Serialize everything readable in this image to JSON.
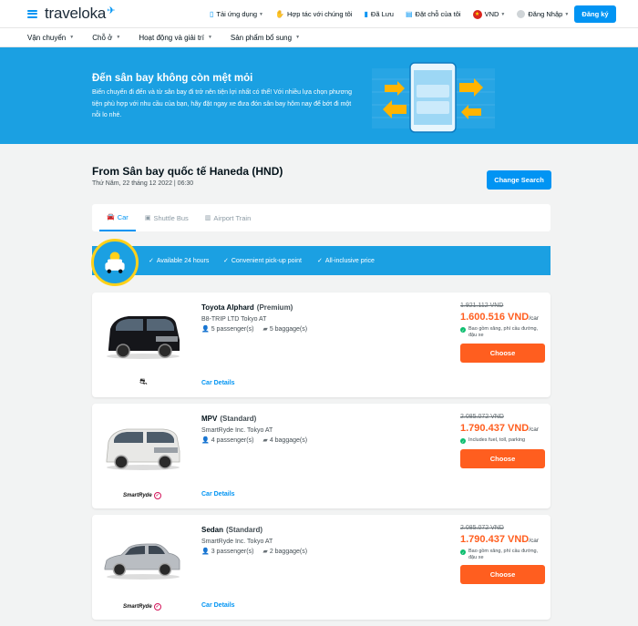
{
  "header": {
    "logo_text": "traveloka",
    "nav": {
      "download": "Tải ứng dụng",
      "partner": "Hợp tác với chúng tôi",
      "saved": "Đã Lưu",
      "bookings": "Đặt chỗ của tôi",
      "currency": "VND",
      "login": "Đăng Nhập",
      "signup": "Đăng ký"
    },
    "subnav": [
      "Vận chuyển",
      "Chỗ ở",
      "Hoạt động và giải trí",
      "Sản phẩm bổ sung"
    ]
  },
  "banner": {
    "title": "Đến sân bay không còn mệt mỏi",
    "text": "Biến chuyến đi đến và từ sân bay đi trở nên tiện lợi nhất có thể! Với nhiều lựa chọn phương tiện phù hợp với nhu cầu của bạn, hãy đặt ngay xe đưa đón sân bay hôm nay để bớt đi một nỗi lo nhé."
  },
  "search": {
    "title": "From Sân bay quốc tế Haneda (HND)",
    "date": "Thứ Năm, 22 tháng 12 2022 | 06:30",
    "change_label": "Change Search"
  },
  "tabs": [
    {
      "label": "Car",
      "active": true
    },
    {
      "label": "Shuttle Bus",
      "active": false
    },
    {
      "label": "Airport Train",
      "active": false
    }
  ],
  "features": [
    "Available 24 hours",
    "Convenient pick-up point",
    "All-inclusive price"
  ],
  "cards": [
    {
      "name": "Toyota Alphard",
      "class": "(Premium)",
      "provider": "B8-TRIP LTD Tokyo AT",
      "passengers": "5 passenger(s)",
      "baggage": "5 baggage(s)",
      "details": "Car Details",
      "old_price": "1.921.112 VND",
      "price": "1.600.516 VND",
      "unit": "/car",
      "inclusion": "Bao gồm xăng, phí cầu đường, đậu xe",
      "choose": "Choose",
      "vendor": ""
    },
    {
      "name": "MPV",
      "class": "(Standard)",
      "provider": "SmartRyde Inc. Tokyo AT",
      "passengers": "4 passenger(s)",
      "baggage": "4 baggage(s)",
      "details": "Car Details",
      "old_price": "2.085.072 VND",
      "price": "1.790.437 VND",
      "unit": "/car",
      "inclusion": "Includes fuel, toll, parking",
      "choose": "Choose",
      "vendor": "SmartRyde"
    },
    {
      "name": "Sedan",
      "class": "(Standard)",
      "provider": "SmartRyde Inc. Tokyo AT",
      "passengers": "3 passenger(s)",
      "baggage": "2 baggage(s)",
      "details": "Car Details",
      "old_price": "2.085.072 VND",
      "price": "1.790.437 VND",
      "unit": "/car",
      "inclusion": "Bao gồm xăng, phí cầu đường, đậu xe",
      "choose": "Choose",
      "vendor": "SmartRyde"
    }
  ],
  "colors": {
    "brand": "#0194f3",
    "banner": "#1ba0e2",
    "price": "#ff5e1f",
    "badge_ring": "#ffd11a"
  }
}
